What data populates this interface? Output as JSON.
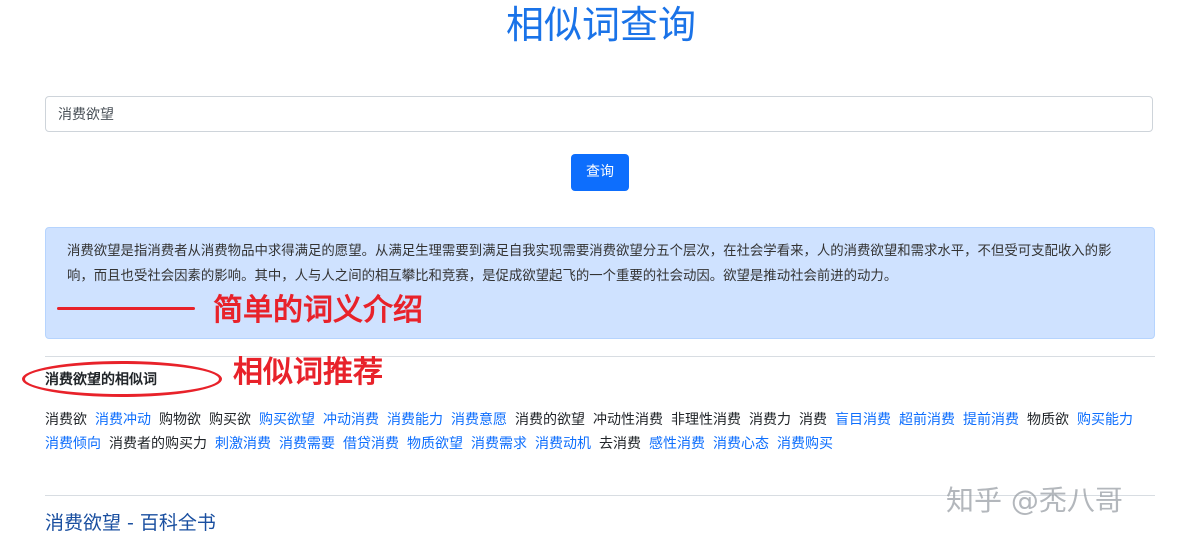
{
  "page": {
    "title": "相似词查询"
  },
  "search": {
    "value": "消费欲望",
    "button_label": "查询"
  },
  "definition": {
    "text": "消费欲望是指消费者从消费物品中求得满足的愿望。从满足生理需要到满足自我实现需要消费欲望分五个层次，在社会学看来，人的消费欲望和需求水平，不但受可支配收入的影响，而且也受社会因素的影响。其中，人与人之间的相互攀比和竞赛，是促成欲望起飞的一个重要的社会动因。欲望是推动社会前进的动力。"
  },
  "annotations": {
    "definition_note": "简单的词义介绍",
    "similar_note": "相似词推荐"
  },
  "similar": {
    "heading": "消费欲望的相似词",
    "words": [
      {
        "text": "消费欲",
        "link": false
      },
      {
        "text": "消费冲动",
        "link": true
      },
      {
        "text": "购物欲",
        "link": false
      },
      {
        "text": "购买欲",
        "link": false
      },
      {
        "text": "购买欲望",
        "link": true
      },
      {
        "text": "冲动消费",
        "link": true
      },
      {
        "text": "消费能力",
        "link": true
      },
      {
        "text": "消费意愿",
        "link": true
      },
      {
        "text": "消费的欲望",
        "link": false
      },
      {
        "text": "冲动性消费",
        "link": false
      },
      {
        "text": "非理性消费",
        "link": false
      },
      {
        "text": "消费力",
        "link": false
      },
      {
        "text": "消费",
        "link": false
      },
      {
        "text": "盲目消费",
        "link": true
      },
      {
        "text": "超前消费",
        "link": true
      },
      {
        "text": "提前消费",
        "link": true
      },
      {
        "text": "物质欲",
        "link": false
      },
      {
        "text": "购买能力",
        "link": true
      },
      {
        "text": "消费倾向",
        "link": true
      },
      {
        "text": "消费者的购买力",
        "link": false
      },
      {
        "text": "刺激消费",
        "link": true
      },
      {
        "text": "消费需要",
        "link": true
      },
      {
        "text": "借贷消费",
        "link": true
      },
      {
        "text": "物质欲望",
        "link": true
      },
      {
        "text": "消费需求",
        "link": true
      },
      {
        "text": "消费动机",
        "link": true
      },
      {
        "text": "去消费",
        "link": false
      },
      {
        "text": "感性消费",
        "link": true
      },
      {
        "text": "消费心态",
        "link": true
      },
      {
        "text": "消费购买",
        "link": true
      }
    ]
  },
  "encyclopedia": {
    "link_text": "消费欲望 - 百科全书"
  },
  "watermark": {
    "text": "知乎 @秃八哥"
  },
  "colors": {
    "accent": "#0d6efd",
    "annotation": "#e8222a",
    "info_bg": "#cfe2ff"
  }
}
